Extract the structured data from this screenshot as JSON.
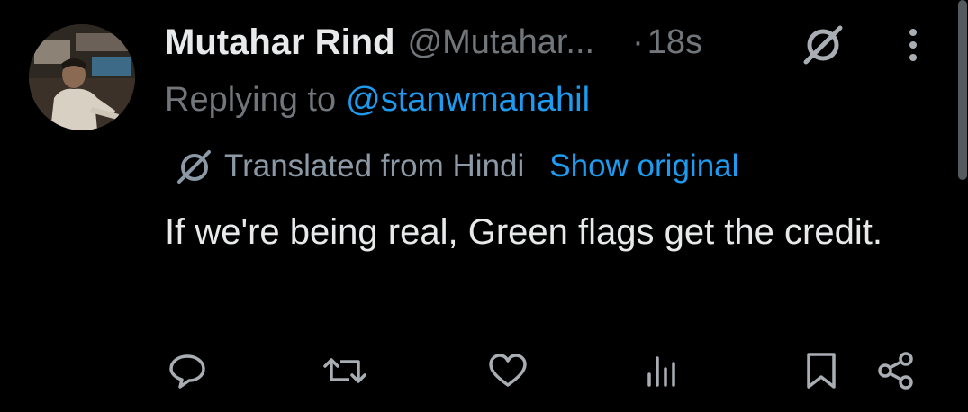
{
  "tweet": {
    "author_name": "Mutahar Rind",
    "author_handle": "@Mutahar...",
    "separator": "·",
    "timestamp": "18s",
    "replying_prefix": "Replying to",
    "replying_handle": "@stanwmanahil",
    "translated_label": "Translated from Hindi",
    "show_original_label": "Show original",
    "text": "If we're being real, Green flags get the credit."
  },
  "icons": {
    "header": [
      "grok-icon",
      "more-options-icon"
    ],
    "translate": "grok-translate-icon",
    "actions": [
      "reply-icon",
      "retweet-icon",
      "like-icon",
      "views-icon",
      "bookmark-icon",
      "share-icon"
    ]
  },
  "colors": {
    "background": "#000000",
    "primary_text": "#e7e9ea",
    "secondary_text": "#71767b",
    "link": "#1d9bf0",
    "icon": "#a8aeb3"
  }
}
